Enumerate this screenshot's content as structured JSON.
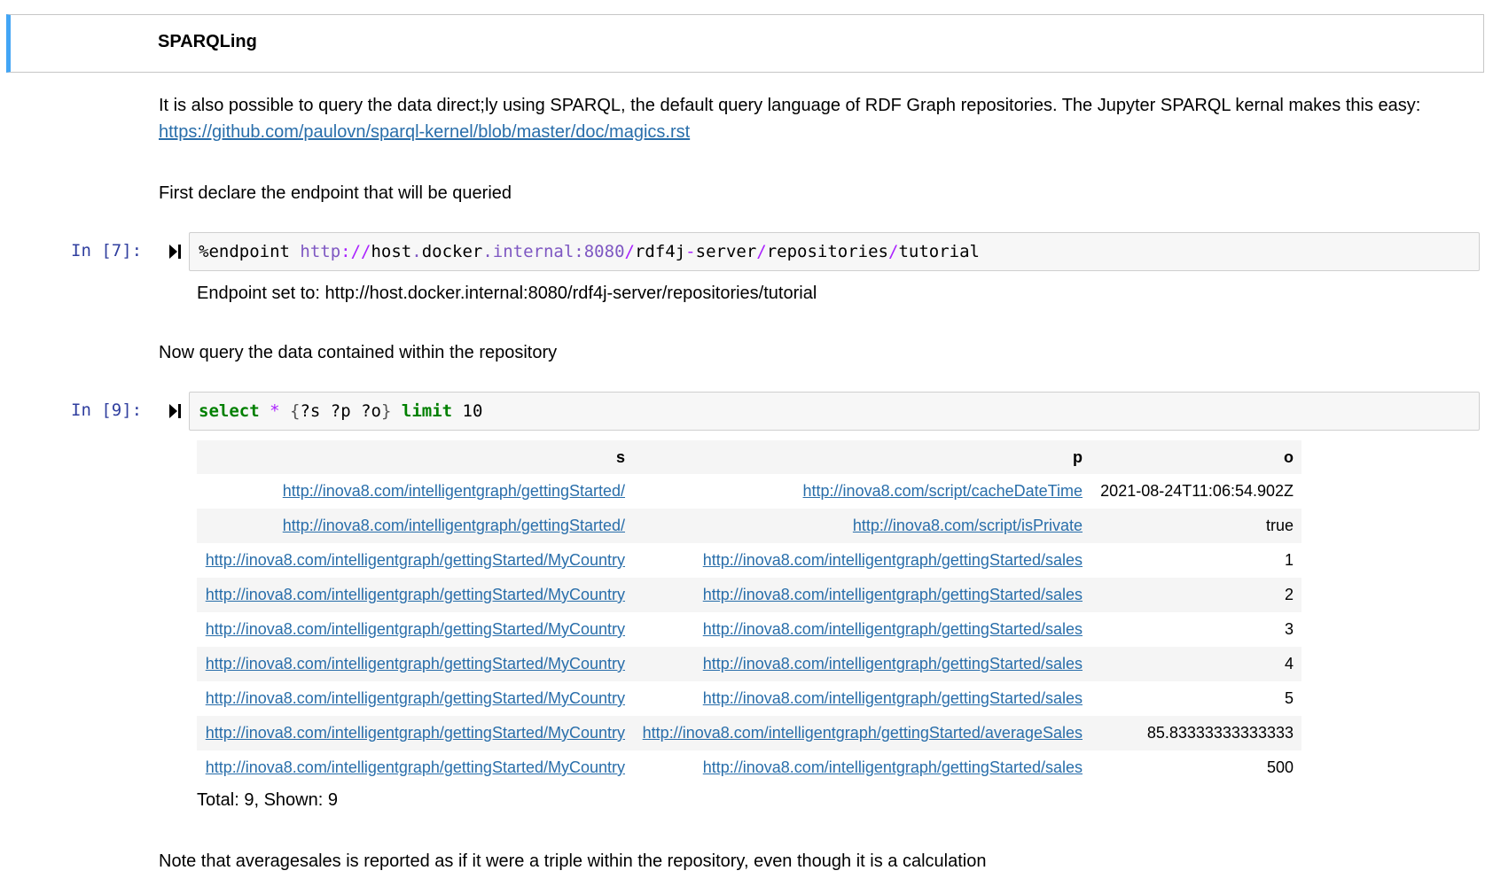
{
  "heading": "SPARQLing",
  "intro": {
    "text": "It is also possible to query the data direct;ly using SPARQL, the default query language of RDF Graph repositories. The Jupyter SPARQL kernal makes this easy: ",
    "link": "https://github.com/paulovn/sparql-kernel/blob/master/doc/magics.rst"
  },
  "step1_text": "First declare the endpoint that will be queried",
  "cell1": {
    "prompt": "In [7]:",
    "code": {
      "magic": "%endpoint ",
      "scheme": "http",
      "sep1": "://",
      "host": "host",
      "dot1": ".",
      "docker": "docker",
      "dot2": ".",
      "internal": "internal:8080",
      "slash1": "/",
      "rdf4j": "rdf4j",
      "dash": "-",
      "server": "server",
      "slash2": "/",
      "repositories": "repositories",
      "slash3": "/",
      "tutorial": "tutorial"
    },
    "output": "Endpoint set to: http://host.docker.internal:8080/rdf4j-server/repositories/tutorial"
  },
  "step2_text": "Now query the data contained within the repository",
  "cell2": {
    "prompt": "In [9]:",
    "code": {
      "select": "select",
      "star": "*",
      "open": "{",
      "vars": "?s ?p ?o",
      "close": "}",
      "limit": "limit",
      "num": "10"
    },
    "table": {
      "headers": [
        "s",
        "p",
        "o"
      ],
      "rows": [
        [
          "http://inova8.com/intelligentgraph/gettingStarted/",
          "http://inova8.com/script/cacheDateTime",
          "2021-08-24T11:06:54.902Z"
        ],
        [
          "http://inova8.com/intelligentgraph/gettingStarted/",
          "http://inova8.com/script/isPrivate",
          "true"
        ],
        [
          "http://inova8.com/intelligentgraph/gettingStarted/MyCountry",
          "http://inova8.com/intelligentgraph/gettingStarted/sales",
          "1"
        ],
        [
          "http://inova8.com/intelligentgraph/gettingStarted/MyCountry",
          "http://inova8.com/intelligentgraph/gettingStarted/sales",
          "2"
        ],
        [
          "http://inova8.com/intelligentgraph/gettingStarted/MyCountry",
          "http://inova8.com/intelligentgraph/gettingStarted/sales",
          "3"
        ],
        [
          "http://inova8.com/intelligentgraph/gettingStarted/MyCountry",
          "http://inova8.com/intelligentgraph/gettingStarted/sales",
          "4"
        ],
        [
          "http://inova8.com/intelligentgraph/gettingStarted/MyCountry",
          "http://inova8.com/intelligentgraph/gettingStarted/sales",
          "5"
        ],
        [
          "http://inova8.com/intelligentgraph/gettingStarted/MyCountry",
          "http://inova8.com/intelligentgraph/gettingStarted/averageSales",
          "85.83333333333333"
        ],
        [
          "http://inova8.com/intelligentgraph/gettingStarted/MyCountry",
          "http://inova8.com/intelligentgraph/gettingStarted/sales",
          "500"
        ]
      ]
    },
    "summary": "Total: 9, Shown: 9"
  },
  "note_text": "Note that averagesales is reported as if it were a triple within the repository, even though it is a calculation",
  "colors": {
    "prompt": "#303f9f",
    "link": "#296eaa",
    "selected_bar": "#42a5f5",
    "keyword": "#008000"
  }
}
